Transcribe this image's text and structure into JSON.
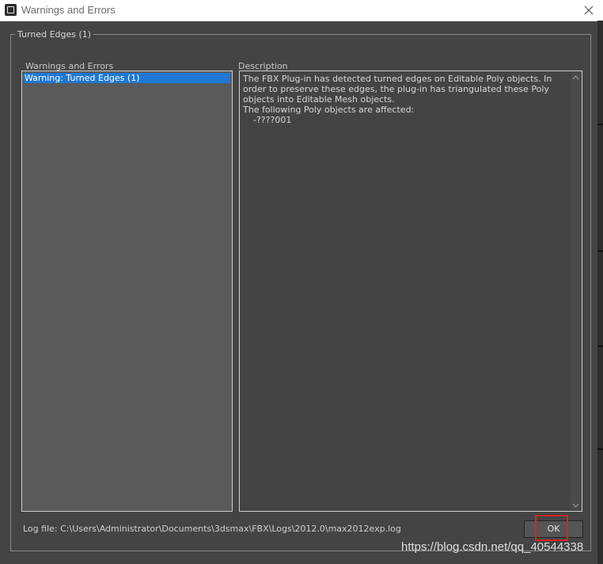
{
  "window": {
    "title": "Warnings and Errors",
    "close_icon": "close-icon",
    "app_icon": "3dsmax-app-icon"
  },
  "group": {
    "legend": "Turned Edges (1)"
  },
  "warnings_list": {
    "header": "Warnings and Errors",
    "items": [
      {
        "label": "Warning: Turned Edges (1)",
        "selected": true
      }
    ]
  },
  "description": {
    "header": "Description",
    "paragraph": "The FBX Plug-in has detected turned edges on Editable Poly objects. In order to preserve these edges, the plug-in has triangulated these Poly objects into Editable Mesh objects.",
    "affected_heading": "The following Poly objects are affected:",
    "affected_objects": [
      "-????001"
    ]
  },
  "footer": {
    "log_file": "Log file: C:\\Users\\Administrator\\Documents\\3dsmax\\FBX\\Logs\\2012.0\\max2012exp.log",
    "ok_label": "OK"
  },
  "watermark": "https://blog.csdn.net/qq_40544338",
  "colors": {
    "background": "#444444",
    "selection": "#1e78d4",
    "highlight": "#e02020"
  }
}
